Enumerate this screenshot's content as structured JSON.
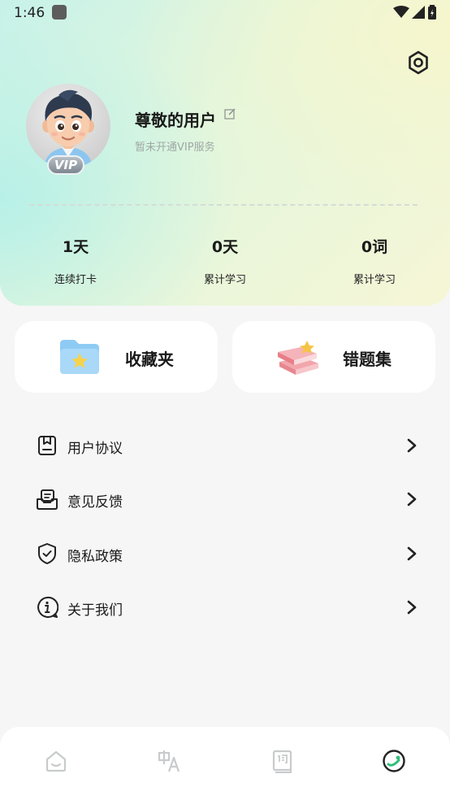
{
  "status_bar": {
    "time": "1:46"
  },
  "profile": {
    "user_name": "尊敬的用户",
    "vip_status": "暂未开通VIP服务",
    "vip_badge": "VIP"
  },
  "stats": [
    {
      "value": "1天",
      "label": "连续打卡"
    },
    {
      "value": "0天",
      "label": "累计学习"
    },
    {
      "value": "0词",
      "label": "累计学习"
    }
  ],
  "cards": {
    "favorites_label": "收藏夹",
    "wrong_questions_label": "错题集"
  },
  "menu": [
    {
      "label": "用户协议",
      "icon": "document-icon"
    },
    {
      "label": "意见反馈",
      "icon": "feedback-inbox-icon"
    },
    {
      "label": "隐私政策",
      "icon": "shield-check-icon"
    },
    {
      "label": "关于我们",
      "icon": "info-icon"
    }
  ],
  "bottom_nav": [
    {
      "icon": "home-icon",
      "active": false
    },
    {
      "icon": "translate-icon",
      "active": false
    },
    {
      "icon": "dictionary-icon",
      "active": false
    },
    {
      "icon": "profile-icon",
      "active": true
    }
  ],
  "colors": {
    "accent_green": "#2dbf7a",
    "text_primary": "#1a1a1a",
    "text_secondary": "#a0a7a5",
    "background": "#f6f6f7"
  }
}
